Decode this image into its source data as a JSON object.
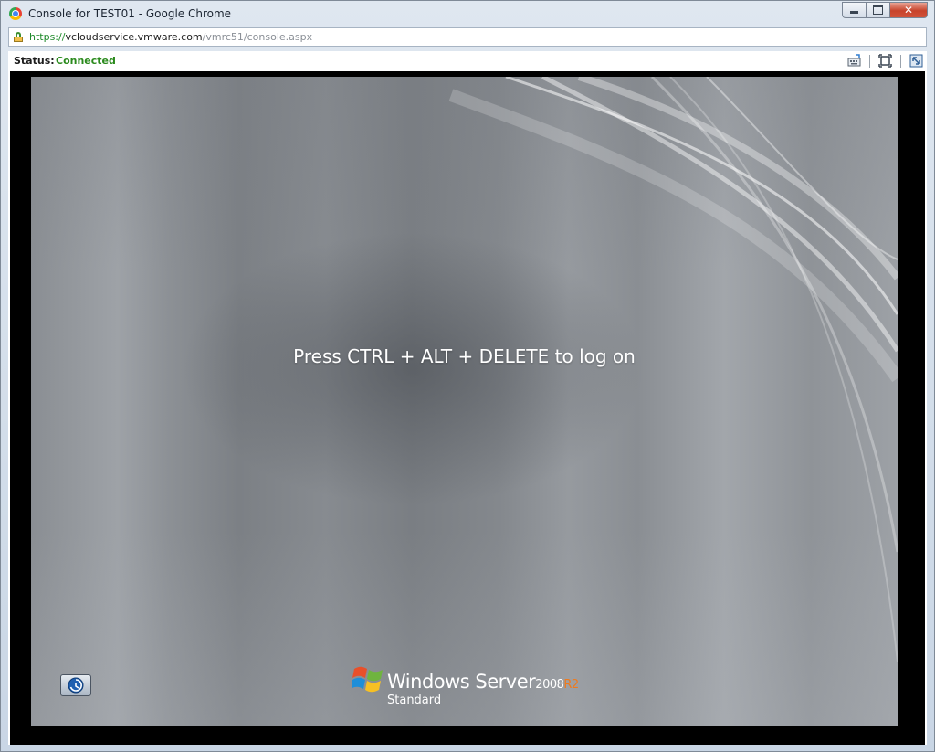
{
  "window": {
    "title": "Console for TEST01 - Google Chrome",
    "controls": {
      "minimize_icon": "minimize-icon",
      "maximize_icon": "maximize-icon",
      "close_label": "✕"
    }
  },
  "address_bar": {
    "scheme": "https://",
    "host": "vcloudservice.vmware.com",
    "path": "/vmrc51/console.aspx",
    "secure_icon": "lock-icon"
  },
  "status_bar": {
    "label": "Status:",
    "value": "Connected",
    "value_color": "#2a8a1c"
  },
  "toolbar": {
    "icons": [
      "send-keys-icon",
      "fullscreen-icon",
      "popout-icon"
    ]
  },
  "console": {
    "message": "Press CTRL + ALT + DELETE to log on",
    "accessibility_icon": "ease-of-access-icon",
    "branding": {
      "product": "Windows Server",
      "version": "2008",
      "release": "R2",
      "edition": "Standard",
      "logo_icon": "windows-flag-icon",
      "release_color": "#f07a1c"
    }
  },
  "colors": {
    "frame_background": "#000000",
    "screen_base": "#8a8e93",
    "window_chrome": "#dfe7f0"
  }
}
